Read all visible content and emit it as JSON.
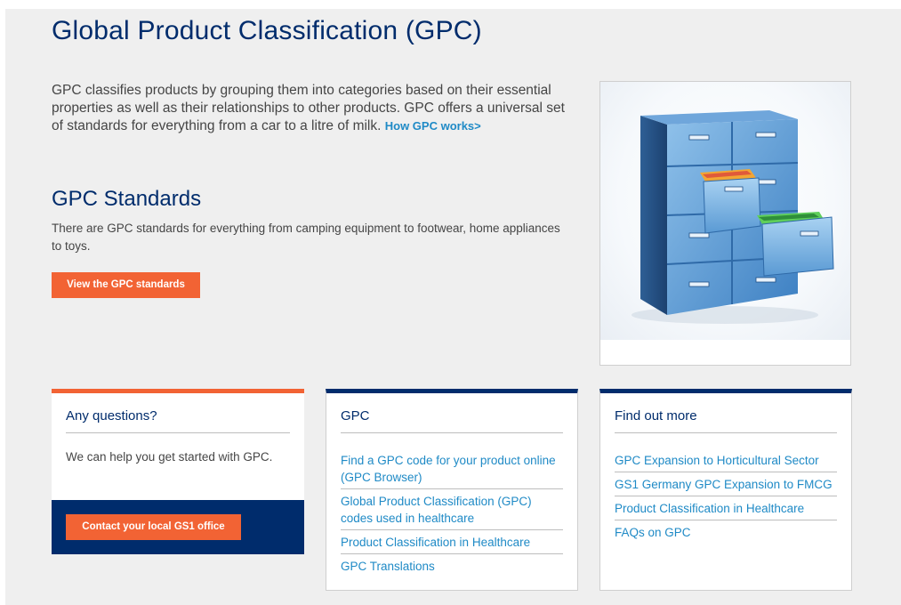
{
  "page": {
    "title": "Global Product Classification (GPC)",
    "intro": "GPC classifies products by grouping them into categories based on their essential properties as well as their relationships to other products. GPC offers a universal set of standards for everything from a car to a litre of milk.",
    "intro_link": "How GPC works>"
  },
  "standards": {
    "heading": "GPC Standards",
    "text": "There are GPC standards for everything from camping equipment to footwear, home appliances to toys.",
    "button_label": "View the GPC standards"
  },
  "image": {
    "subject": "filing-cabinet"
  },
  "cards": {
    "questions": {
      "title": "Any questions?",
      "text": "We can help you get started with GPC.",
      "button_label": "Contact your local GS1 office"
    },
    "gpc": {
      "title": "GPC",
      "links": [
        "Find a GPC code for your product online (GPC Browser)",
        "Global Product Classification (GPC) codes used in healthcare",
        "Product Classification in Healthcare",
        "GPC Translations"
      ]
    },
    "find_out_more": {
      "title": "Find out more",
      "links": [
        "GPC Expansion to Horticultural Sector",
        "GS1 Germany GPC Expansion to FMCG",
        "Product Classification in Healthcare",
        "FAQs on GPC"
      ]
    }
  },
  "colors": {
    "navy": "#002c6c",
    "orange": "#f26334",
    "link_blue": "#1f8ac6",
    "text_gray": "#454545"
  }
}
